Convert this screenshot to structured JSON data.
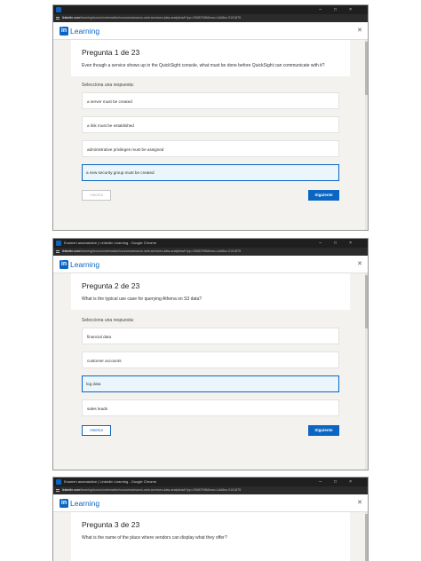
{
  "shots": [
    {
      "window_title": "",
      "url_domain": "linkedin.com",
      "url_path": "/learning/toumo/unternative/courses/amazon-web-services-data-analytics/h?pp=30687998&ess=LAA8w=2101875",
      "logo_text": "Learning",
      "question_number": "Pregunta 1 de 23",
      "question_text": "Even though a service shows up in the QuickSight console, what must be done before QuickSight can communicate with it?",
      "prompt": "Selecciona una respuesta:",
      "options": [
        {
          "label": "a server must be created",
          "selected": false
        },
        {
          "label": "a link must be established",
          "selected": false
        },
        {
          "label": "administrative privileges must be assigned",
          "selected": false
        },
        {
          "label": "a new security group must be created",
          "selected": true
        }
      ],
      "prev_label": "Anterior",
      "prev_disabled": true,
      "next_label": "Siguiente"
    },
    {
      "window_title": "Examen anamaiolive | LinkedIn Learning - Google Chrome",
      "url_domain": "linkedin.com",
      "url_path": "/learning/toumo/unternative/courses/amazon-web-services-data-analytics/h?pp=30687998&ess=LAA8w=2101875",
      "logo_text": "Learning",
      "question_number": "Pregunta 2 de 23",
      "question_text": "What is the typical use case for querying Athena on S3 data?",
      "prompt": "Selecciona una respuesta:",
      "options": [
        {
          "label": "financial data",
          "selected": false
        },
        {
          "label": "customer accounts",
          "selected": false
        },
        {
          "label": "log data",
          "selected": true
        },
        {
          "label": "sales leads",
          "selected": false
        }
      ],
      "prev_label": "Anterior",
      "prev_disabled": false,
      "next_label": "Siguiente"
    },
    {
      "window_title": "Examen anamaiolive | LinkedIn Learning - Google Chrome",
      "url_domain": "linkedin.com",
      "url_path": "/learning/toumo/unternative/courses/amazon-web-services-data-analytics/h?pp=30687998&ess=LAA8w=2101875",
      "logo_text": "Learning",
      "question_number": "Pregunta 3 de 23",
      "question_text": "What is the name of the place where vendors can display what they offer?"
    }
  ],
  "icons": {
    "logo": "linkedin-in-icon",
    "close": "close-icon",
    "window_controls": "minimize-maximize-close-icons",
    "site_info": "tune-icon"
  },
  "colors": {
    "brand": "#0a66c2",
    "selected_bg": "#eaf6fb",
    "page_bg": "#f3f2ef",
    "titlebar": "#1f1f1f"
  }
}
